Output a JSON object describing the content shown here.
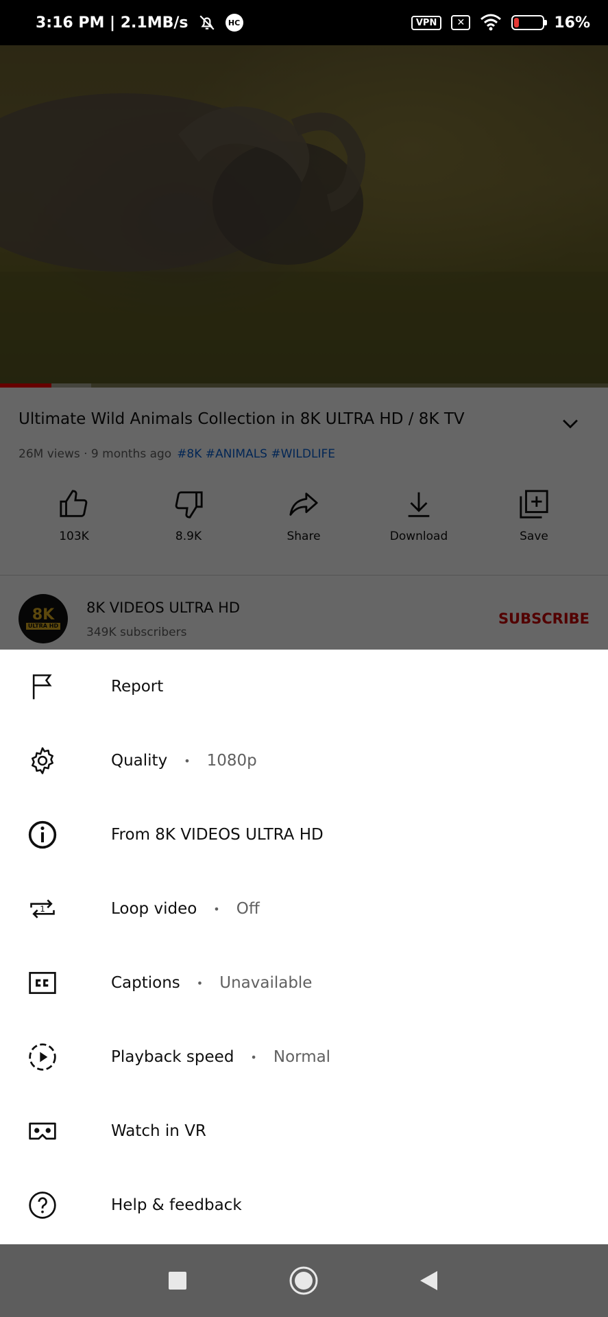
{
  "status_bar": {
    "time_speed": "3:16 PM | 2.1MB/s",
    "hc": "HC",
    "vpn": "VPN",
    "x_box": "✕",
    "battery": "16%",
    "battery_level": 0.16
  },
  "video": {
    "progress_played": 0.085,
    "progress_buffered": 0.15,
    "title": "Ultimate Wild Animals Collection in 8K ULTRA HD / 8K TV",
    "views_age": "26M views · 9 months ago",
    "tags": "#8K #ANIMALS #WILDLIFE"
  },
  "actions": [
    {
      "label": "103K"
    },
    {
      "label": "8.9K"
    },
    {
      "label": "Share"
    },
    {
      "label": "Download"
    },
    {
      "label": "Save"
    }
  ],
  "channel": {
    "avatar_text": "8K",
    "avatar_sub": "ULTRA HD",
    "name": "8K VIDEOS ULTRA HD",
    "subscribers": "349K subscribers",
    "subscribe_label": "SUBSCRIBE"
  },
  "menu": {
    "report": "Report",
    "quality": {
      "label": "Quality",
      "value": "1080p"
    },
    "from": "From 8K VIDEOS ULTRA HD",
    "loop": {
      "label": "Loop video",
      "value": "Off"
    },
    "captions": {
      "label": "Captions",
      "value": "Unavailable"
    },
    "speed": {
      "label": "Playback speed",
      "value": "Normal"
    },
    "vr": "Watch in VR",
    "help": "Help & feedback"
  },
  "colors": {
    "accent_red": "#ff0000",
    "subscribe_red": "#cc0000",
    "link_blue": "#065fd4"
  }
}
